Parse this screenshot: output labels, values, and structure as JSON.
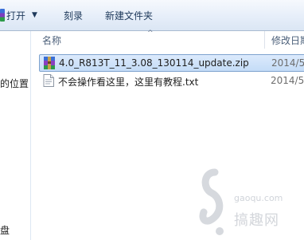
{
  "toolbar": {
    "open_label": "打开",
    "burn_label": "刻录",
    "new_folder_label": "新建文件夹"
  },
  "nav": {
    "recent_label": "的位置",
    "disk_label": "盘"
  },
  "columns": {
    "name": "名称",
    "date_modified": "修改日期"
  },
  "files": [
    {
      "name": "4.0_R813T_11_3.08_130114_update.zip",
      "date": "2014/5/",
      "icon": "winrar-archive-icon",
      "selected": true
    },
    {
      "name": "不会操作看这里，这里有教程.txt",
      "date": "2014/5/",
      "icon": "text-file-icon",
      "selected": false
    }
  ],
  "watermark": {
    "url": "gaoqu.com",
    "brand": "搞趣网"
  }
}
